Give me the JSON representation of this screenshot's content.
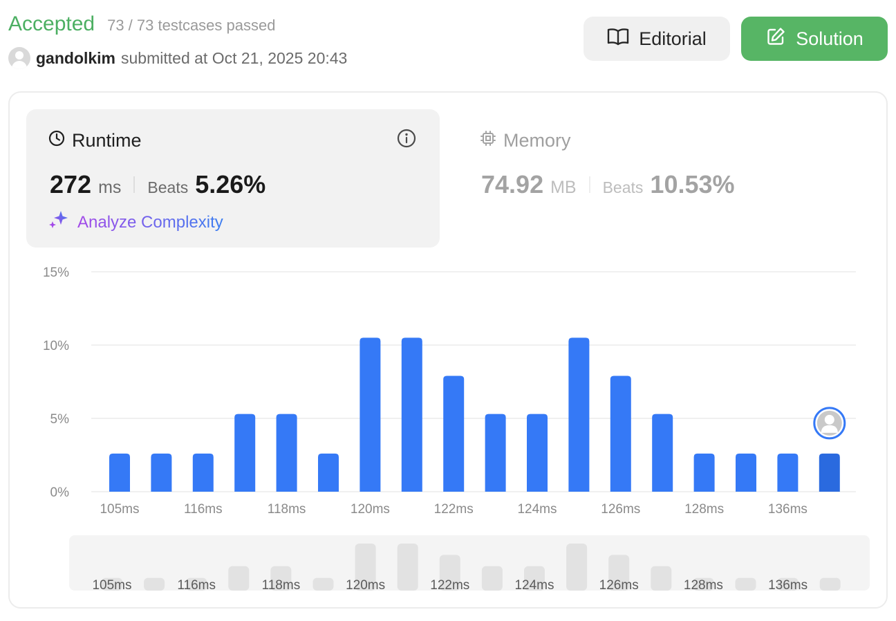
{
  "submission": {
    "status": "Accepted",
    "testcases": "73 / 73 testcases passed",
    "username": "gandolkim",
    "submitted_text": "submitted at Oct 21, 2025 20:43"
  },
  "buttons": {
    "editorial": "Editorial",
    "solution": "Solution"
  },
  "runtime": {
    "title": "Runtime",
    "value": "272",
    "unit": "ms",
    "beats_label": "Beats",
    "beats_value": "5.26%",
    "analyze_label": "Analyze Complexity"
  },
  "memory": {
    "title": "Memory",
    "value": "74.92",
    "unit": "MB",
    "beats_label": "Beats",
    "beats_value": "10.53%"
  },
  "colors": {
    "accepted": "#4caf62",
    "bar": "#3579f6",
    "bar_active": "#2a6adf",
    "solution_button": "#57b565"
  },
  "chart_data": {
    "type": "bar",
    "ylim": [
      0,
      15
    ],
    "yticks": [
      "0%",
      "5%",
      "10%",
      "15%"
    ],
    "values": [
      2.6,
      2.6,
      2.6,
      5.3,
      5.3,
      2.6,
      10.5,
      10.5,
      7.9,
      5.3,
      5.3,
      10.5,
      7.9,
      5.3,
      2.6,
      2.6,
      2.6,
      2.6
    ],
    "x_tick_labels": [
      "105ms",
      "116ms",
      "118ms",
      "120ms",
      "122ms",
      "124ms",
      "126ms",
      "128ms",
      "136ms"
    ],
    "highlight_index": 17,
    "grid": true,
    "overview_tick_labels": [
      "105ms",
      "116ms",
      "118ms",
      "120ms",
      "122ms",
      "124ms",
      "126ms",
      "128ms",
      "136ms"
    ]
  }
}
